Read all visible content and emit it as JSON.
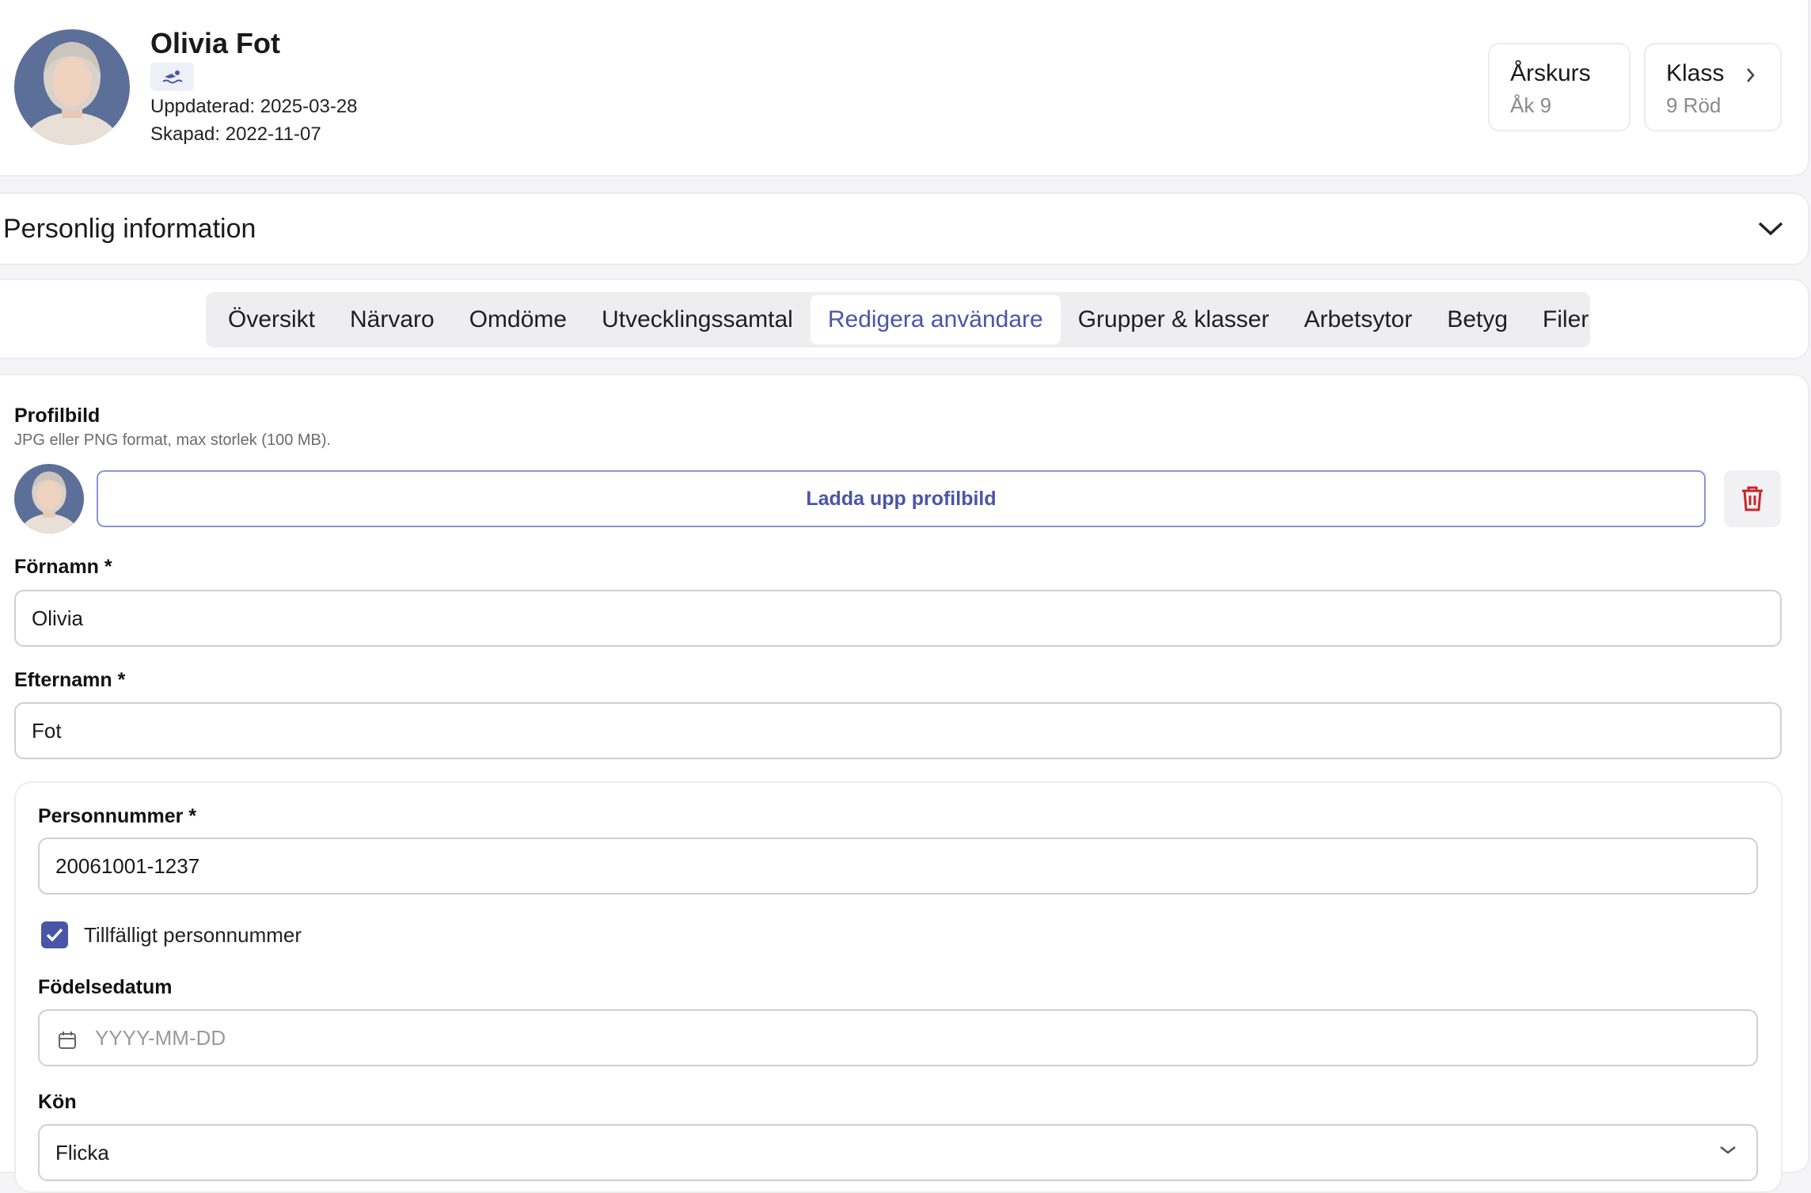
{
  "header": {
    "name": "Olivia Fot",
    "updated": "Uppdaterad: 2025-03-28",
    "created": "Skapad: 2022-11-07",
    "badge_icon": "swimmer-icon",
    "stats": [
      {
        "label": "Årskurs",
        "value": "Åk 9"
      },
      {
        "label": "Klass",
        "value": "9 Röd"
      }
    ]
  },
  "personal_info": {
    "title": "Personlig information"
  },
  "tabs": [
    {
      "label": "Översikt"
    },
    {
      "label": "Närvaro"
    },
    {
      "label": "Omdöme"
    },
    {
      "label": "Utvecklingssamtal"
    },
    {
      "label": "Redigera användare",
      "active": true
    },
    {
      "label": "Grupper & klasser"
    },
    {
      "label": "Arbetsytor"
    },
    {
      "label": "Betyg"
    },
    {
      "label": "Filer"
    }
  ],
  "form": {
    "profile_label": "Profilbild",
    "profile_hint": "JPG eller PNG format, max storlek (100 MB).",
    "upload_label": "Ladda upp profilbild",
    "firstname_label": "Förnamn *",
    "firstname_value": "Olivia",
    "lastname_label": "Efternamn *",
    "lastname_value": "Fot",
    "pnr_label": "Personnummer *",
    "pnr_value": "20061001-1237",
    "temp_pnr_label": "Tillfälligt personnummer",
    "temp_pnr_checked": true,
    "birthdate_label": "Födelsedatum",
    "birthdate_placeholder": "YYYY-MM-DD",
    "gender_label": "Kön",
    "gender_value": "Flicka"
  },
  "colors": {
    "accent": "#4a55a8",
    "danger": "#c62828",
    "border": "#cfcfd4"
  }
}
